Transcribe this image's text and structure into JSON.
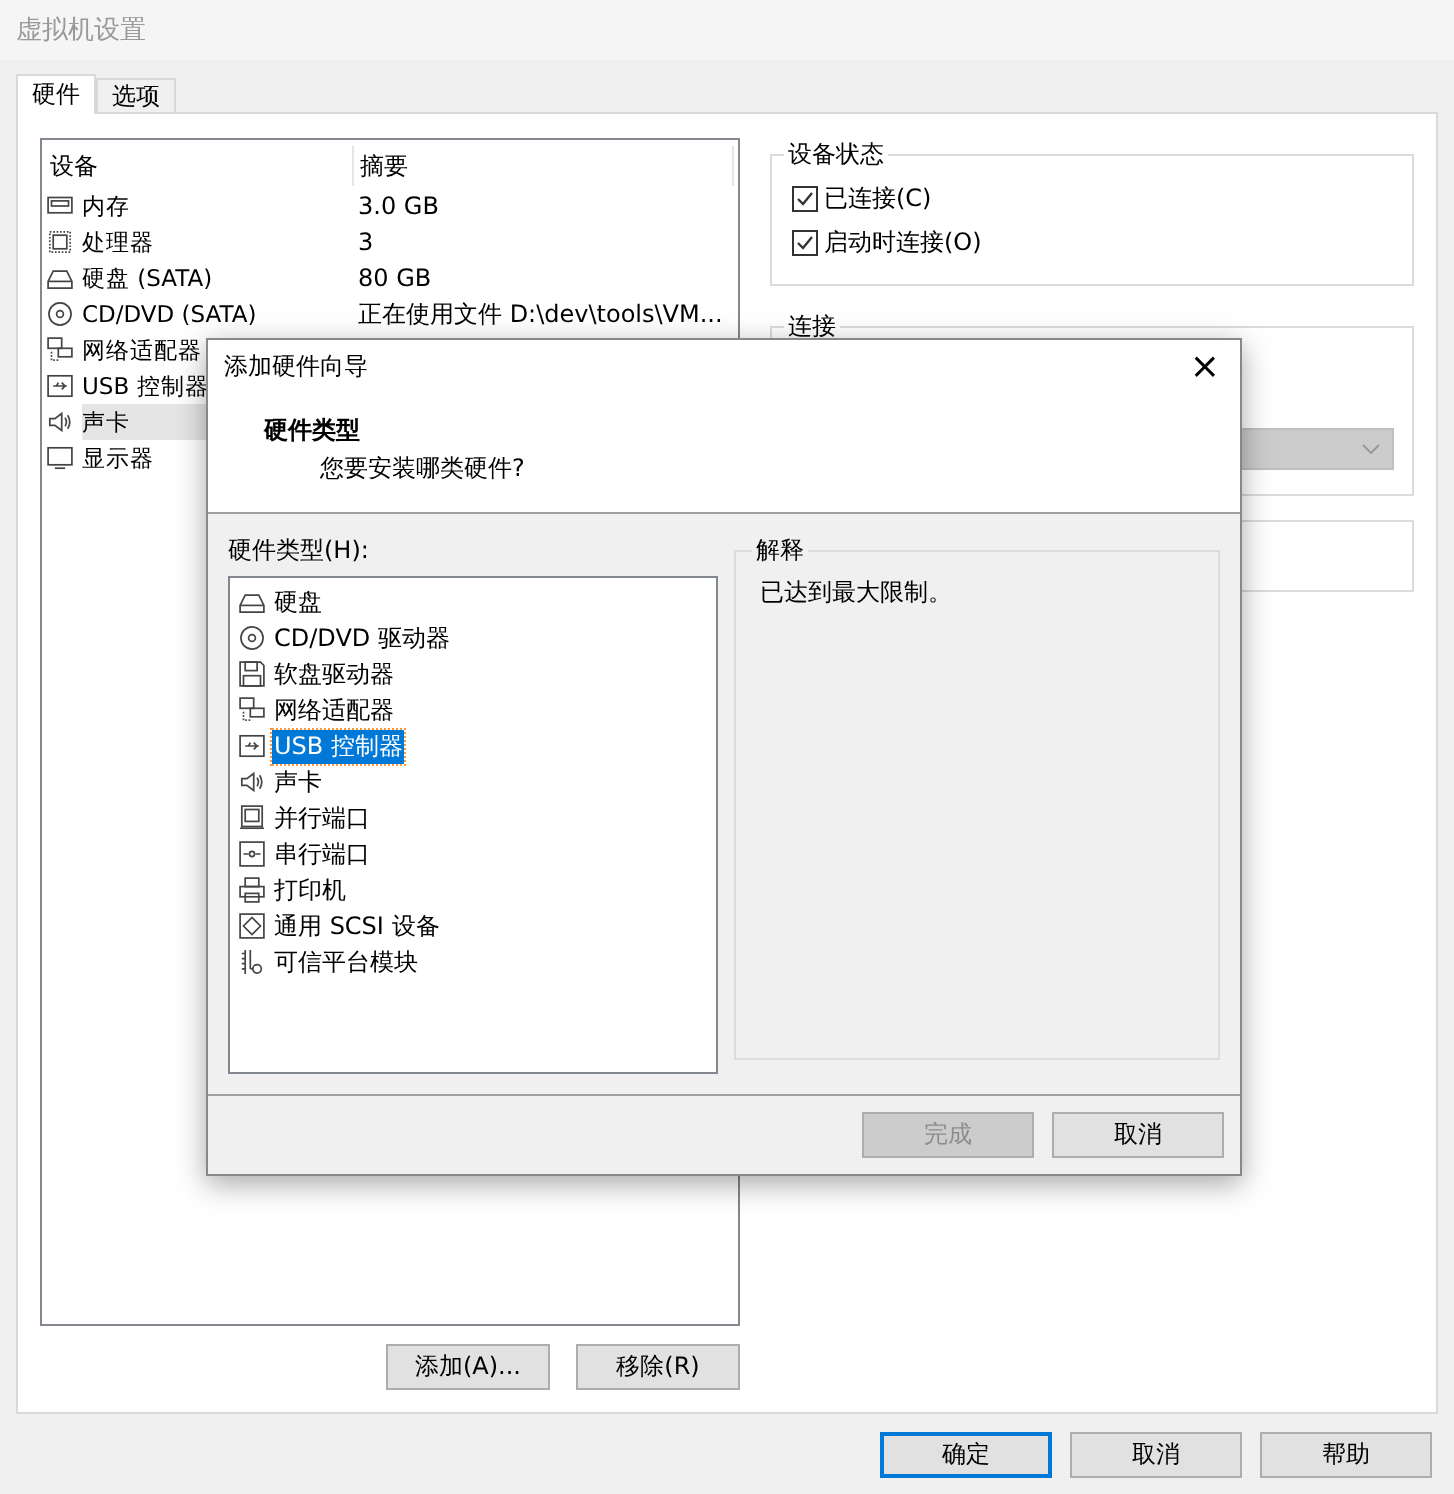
{
  "window": {
    "title": "虚拟机设置"
  },
  "tabs": [
    {
      "label": "硬件",
      "selected": true
    },
    {
      "label": "选项",
      "selected": false
    }
  ],
  "device_table": {
    "columns": [
      "设备",
      "摘要"
    ],
    "rows": [
      {
        "kind": "memory",
        "name": "内存",
        "summary": "3.0 GB",
        "selected": false
      },
      {
        "kind": "cpu",
        "name": "处理器",
        "summary": "3",
        "selected": false
      },
      {
        "kind": "disk",
        "name": "硬盘 (SATA)",
        "summary": "80 GB",
        "selected": false
      },
      {
        "kind": "cd",
        "name": "CD/DVD (SATA)",
        "summary": "正在使用文件 D:\\dev\\tools\\VM...",
        "selected": false
      },
      {
        "kind": "network",
        "name": "网络适配器",
        "selected": false
      },
      {
        "kind": "usb",
        "name": "USB 控制器",
        "selected": false
      },
      {
        "kind": "sound",
        "name": "声卡",
        "selected": true
      },
      {
        "kind": "display",
        "name": "显示器",
        "selected": false
      }
    ]
  },
  "device_buttons": [
    "添加(A)...",
    "移除(R)"
  ],
  "device_status": {
    "title": "设备状态",
    "options": [
      {
        "label": "已连接(C)",
        "checked": true
      },
      {
        "label": "启动时连接(O)",
        "checked": true
      }
    ]
  },
  "connection": {
    "title": "连接",
    "dropdown": {
      "disabled": true
    }
  },
  "footer_buttons": [
    {
      "label": "确定",
      "default": true
    },
    {
      "label": "取消",
      "default": false
    },
    {
      "label": "帮助",
      "default": false
    }
  ],
  "wizard": {
    "title": "添加硬件向导",
    "close": "×",
    "heading": "硬件类型",
    "subheading": "您要安装哪类硬件?",
    "list_label": "硬件类型(H):",
    "items": [
      {
        "kind": "disk",
        "label": "硬盘",
        "selected": false
      },
      {
        "kind": "cd",
        "label": "CD/DVD 驱动器",
        "selected": false
      },
      {
        "kind": "floppy",
        "label": "软盘驱动器",
        "selected": false
      },
      {
        "kind": "network",
        "label": "网络适配器",
        "selected": false
      },
      {
        "kind": "usb",
        "label": "USB 控制器",
        "selected": true
      },
      {
        "kind": "sound",
        "label": "声卡",
        "selected": false
      },
      {
        "kind": "parallel",
        "label": "并行端口",
        "selected": false
      },
      {
        "kind": "serial",
        "label": "串行端口",
        "selected": false
      },
      {
        "kind": "printer",
        "label": "打印机",
        "selected": false
      },
      {
        "kind": "scsi",
        "label": "通用 SCSI 设备",
        "selected": false
      },
      {
        "kind": "tpm",
        "label": "可信平台模块",
        "selected": false
      }
    ],
    "explanation_title": "解释",
    "explanation": "已达到最大限制。",
    "buttons": [
      {
        "label": "完成",
        "disabled": true
      },
      {
        "label": "取消",
        "disabled": false
      }
    ]
  }
}
